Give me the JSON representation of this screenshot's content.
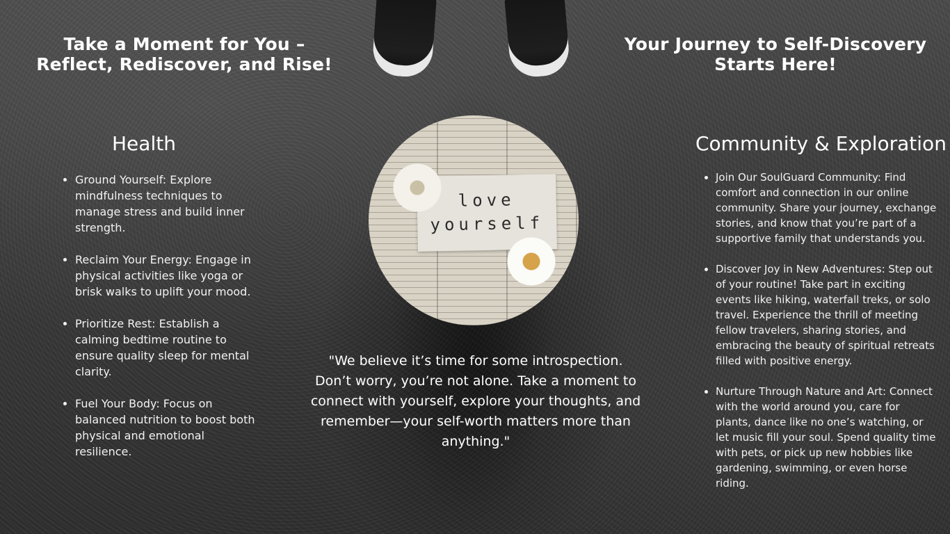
{
  "header": {
    "left_title": "Take a Moment for You – Reflect, Rediscover, and Rise!",
    "right_title": "Your Journey to Self-Discovery Starts Here!"
  },
  "health": {
    "title": "Health",
    "items": [
      "Ground Yourself: Explore mindfulness techniques to manage stress and build inner strength.",
      "Reclaim Your Energy: Engage in physical activities like yoga or brisk walks to uplift your mood.",
      "Prioritize Rest: Establish a calming bedtime routine to ensure quality sleep for mental clarity.",
      "Fuel Your Body: Focus on balanced nutrition to boost both physical and emotional resilience."
    ]
  },
  "community": {
    "title": "Community & Exploration",
    "items": [
      "Join Our SoulGuard Community: Find comfort and connection in our online community. Share your journey, exchange stories, and know that you’re part of a supportive family that understands you.",
      "Discover Joy in New Adventures: Step out of your routine! Take part in exciting events like hiking, waterfall treks, or solo travel. Experience the thrill of meeting fellow travelers, sharing stories, and embracing the beauty of spiritual retreats filled with positive energy.",
      "Nurture Through Nature and Art: Connect with the world around you, care for plants, dance like no one’s watching, or let music fill your soul. Spend quality time with pets, or pick up new hobbies like gardening, swimming, or even horse riding."
    ]
  },
  "image": {
    "note_line1": "love",
    "note_line2": "yourself"
  },
  "quote": "\"We believe it’s time for some introspection. Don’t worry, you’re not alone. Take a moment to connect with yourself, explore your thoughts, and remember—your self-worth matters more than anything.\""
}
